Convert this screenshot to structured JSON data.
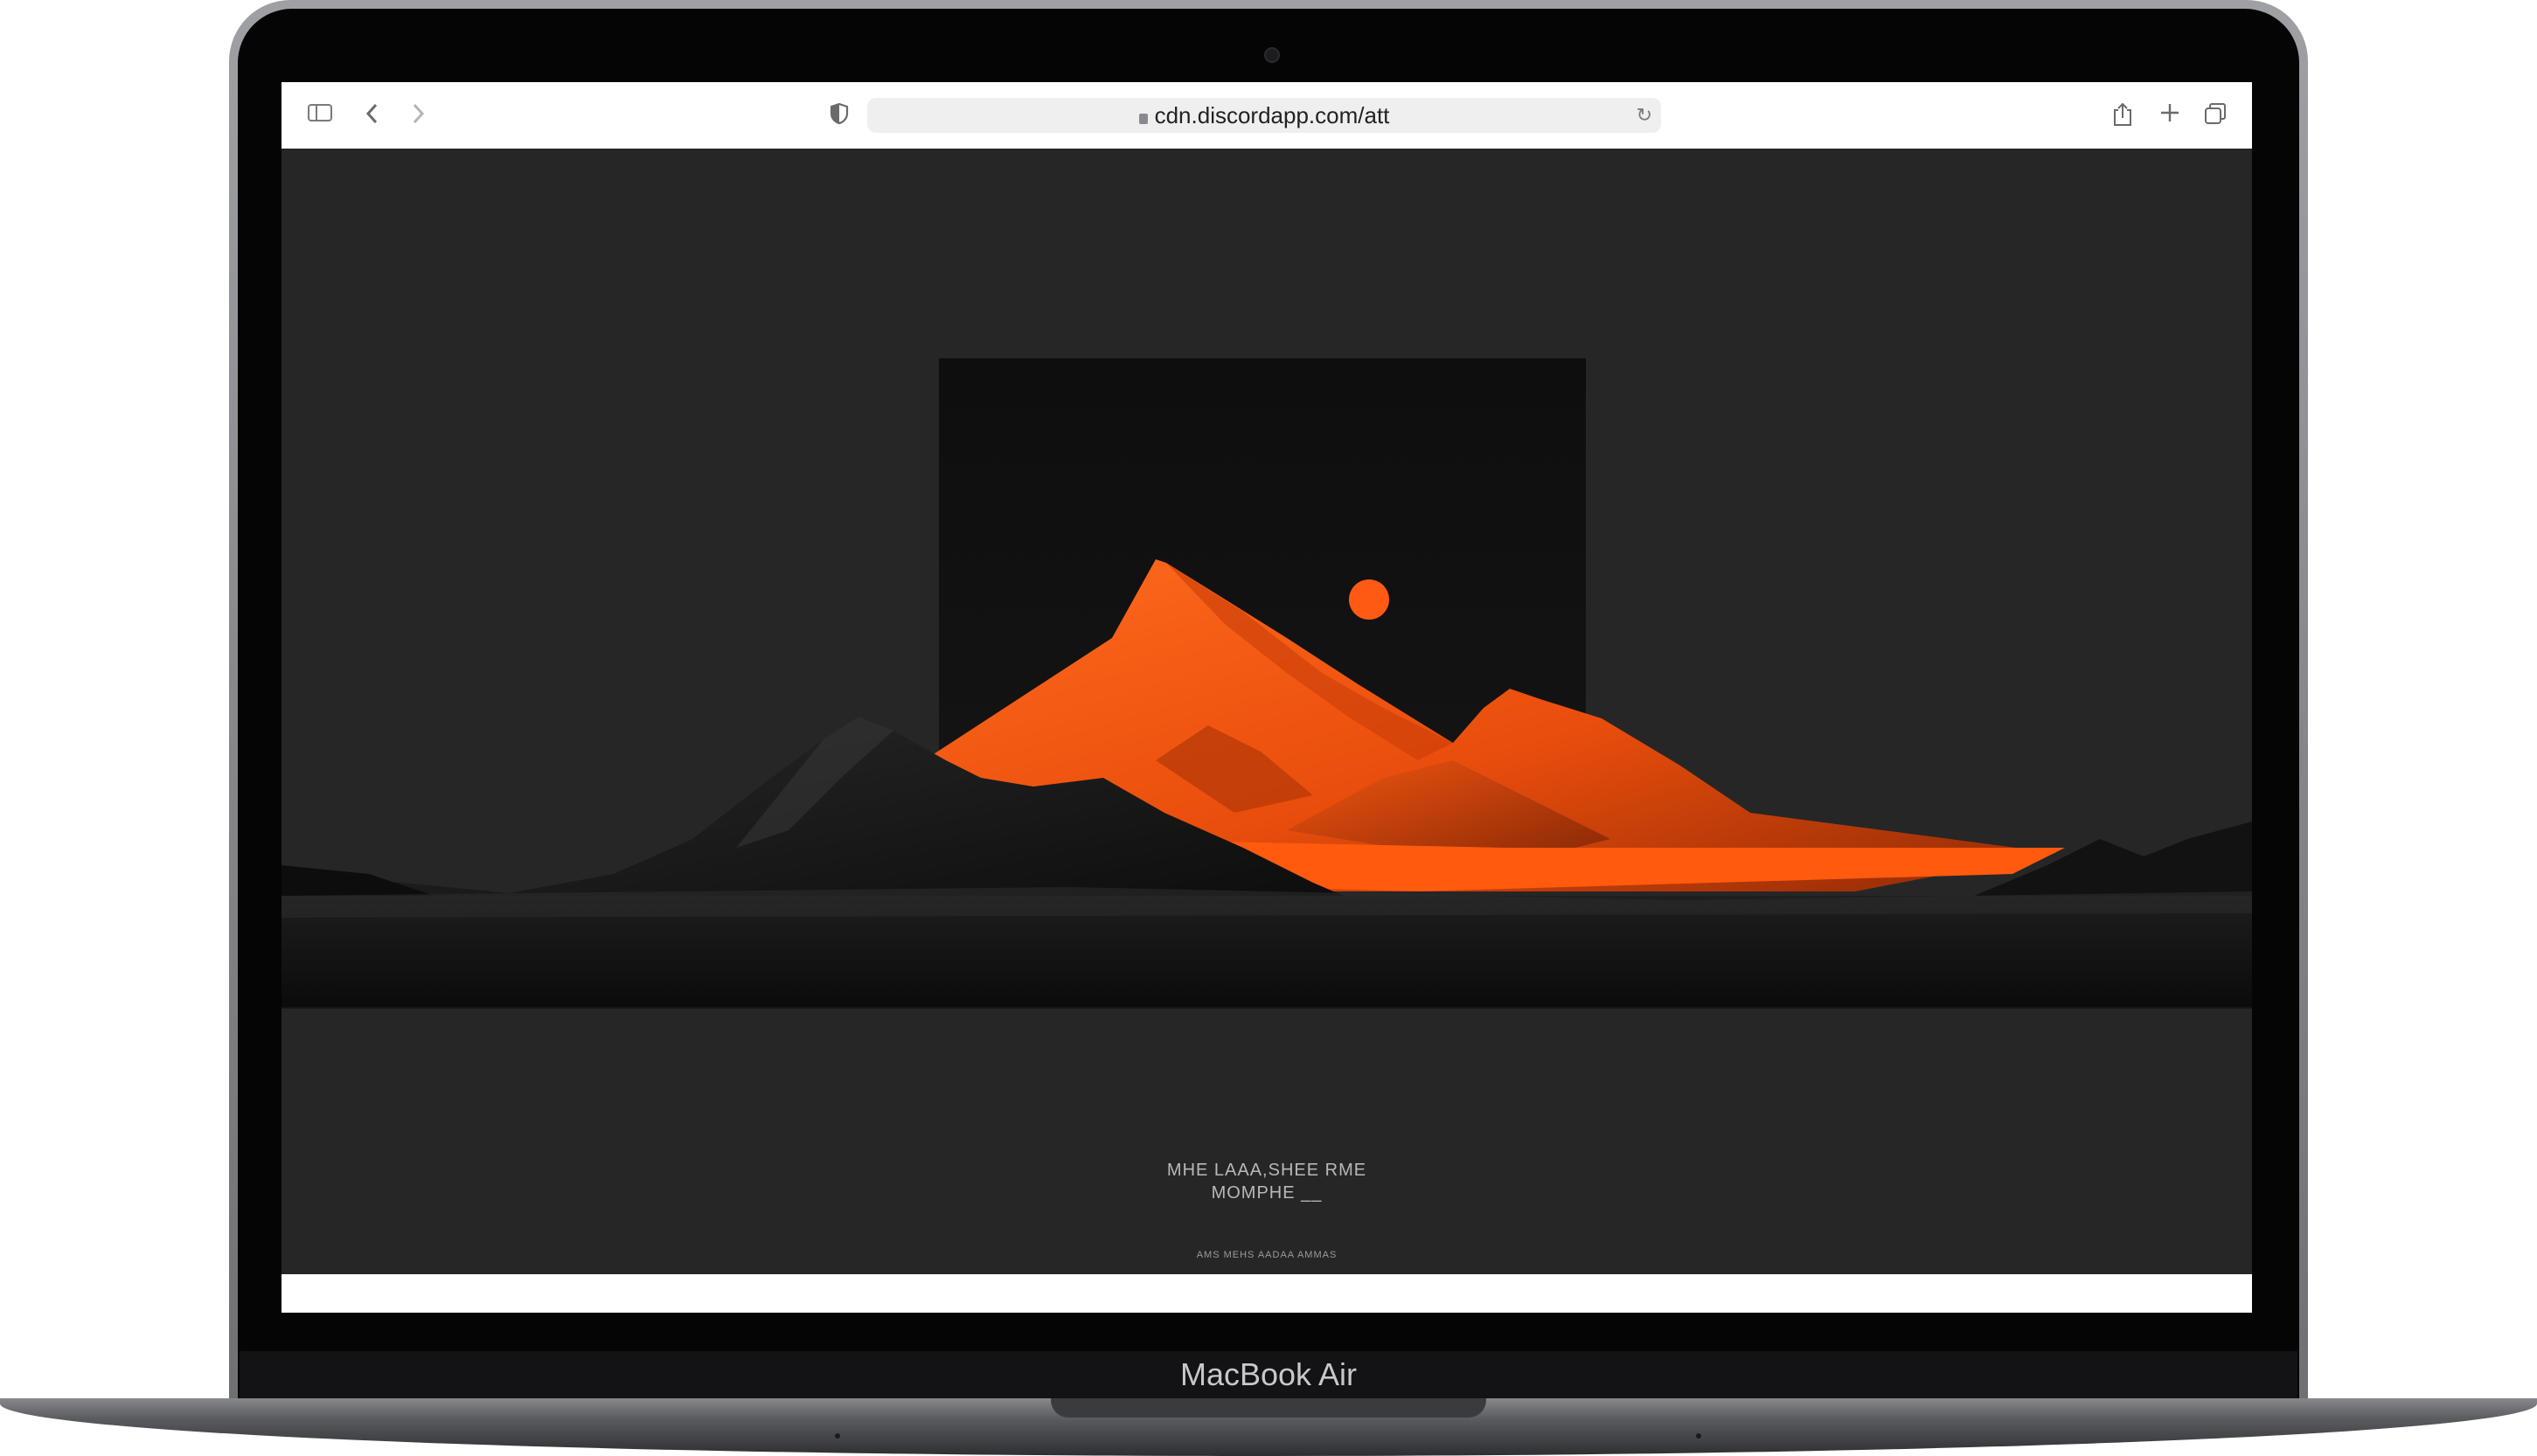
{
  "device": {
    "label": "MacBook Air"
  },
  "browser": {
    "url": "cdn.discordapp.com/att",
    "icons": {
      "sidebar": "sidebar-icon",
      "back": "chevron-left-icon",
      "forward": "chevron-right-icon",
      "privacy": "shield-icon",
      "lock": "lock-icon",
      "reload": "reload-icon",
      "share": "share-icon",
      "new_tab": "plus-icon",
      "tabs": "tabs-overview-icon"
    }
  },
  "page": {
    "caption_line1": "MHE LAAA,SHEE RME",
    "caption_line2": "MOMPHE  __",
    "caption_small": "AMS MEHS AADAA AMMAS",
    "colors": {
      "background": "#262626",
      "accent": "#ff5a14",
      "frame": "#0d0d0d"
    }
  }
}
